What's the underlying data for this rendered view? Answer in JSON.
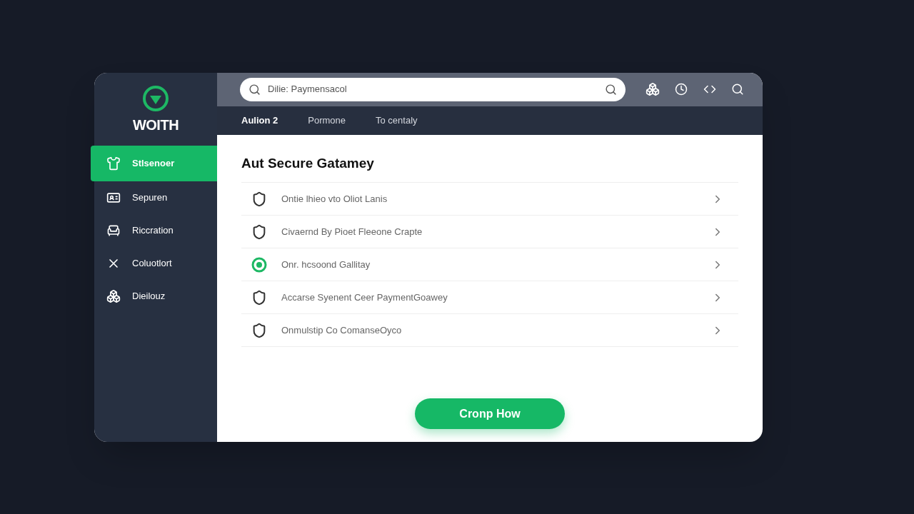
{
  "brand": {
    "name": "WOITH"
  },
  "sidebar": {
    "items": [
      {
        "label": "Stlsenoer",
        "selected": true
      },
      {
        "label": "Sepuren",
        "selected": false
      },
      {
        "label": "Riccration",
        "selected": false
      },
      {
        "label": "Coluotlort",
        "selected": false
      },
      {
        "label": "Dieilouz",
        "selected": false
      }
    ]
  },
  "search": {
    "value": "Dilie: Paymensacol"
  },
  "tabs": [
    {
      "label": "Aulion 2",
      "selected": true
    },
    {
      "label": "Pormone",
      "selected": false
    },
    {
      "label": "To centaly",
      "selected": false
    }
  ],
  "title": "Aut Secure Gatamey",
  "list": [
    {
      "label": "Ontie lhieo vto Oliot Lanis",
      "kind": "shield"
    },
    {
      "label": "Civaernd By Pioet Fleeone Crapte",
      "kind": "shield"
    },
    {
      "label": "Onr. hcsoond Gallitay",
      "kind": "circle"
    },
    {
      "label": "Accarse Syenent Ceer PaymentGoawey",
      "kind": "shield"
    },
    {
      "label": "Onmulstip Co ComanseOyco",
      "kind": "shield"
    }
  ],
  "button": "Cronp How"
}
